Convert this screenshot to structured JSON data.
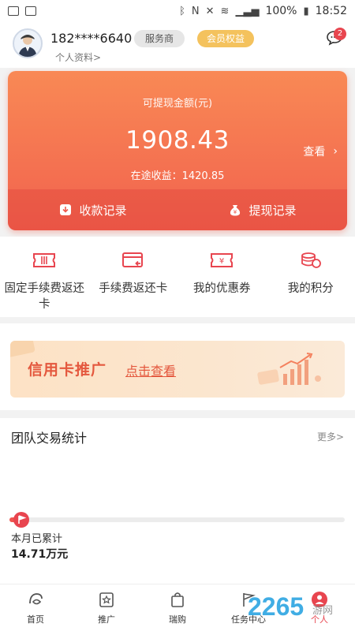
{
  "status_bar": {
    "battery": "100%",
    "time": "18:52"
  },
  "header": {
    "phone": "182****6640",
    "badge_service": "服务商",
    "badge_vip": "会员权益",
    "profile_link": "个人资料>",
    "message_count": "2"
  },
  "earnings": {
    "label": "可提现金额(元)",
    "amount": "1908.43",
    "view_label": "查看",
    "transit": "在途收益：1420.85",
    "receipt_records": "收款记录",
    "withdraw_records": "提现记录"
  },
  "actions": [
    {
      "label": "固定手续费返还卡",
      "icon": "ticket-icon"
    },
    {
      "label": "手续费返还卡",
      "icon": "card-return-icon"
    },
    {
      "label": "我的优惠券",
      "icon": "coupon-icon"
    },
    {
      "label": "我的积分",
      "icon": "coins-icon"
    }
  ],
  "promo": {
    "title": "信用卡推广",
    "link": "点击查看"
  },
  "team_stats": {
    "title": "团队交易统计",
    "more": "更多>",
    "month_label": "本月已累计",
    "month_value": "14.71万元",
    "progress": 0.04
  },
  "nav": [
    {
      "label": "首页",
      "icon": "home-icon"
    },
    {
      "label": "推广",
      "icon": "promote-icon"
    },
    {
      "label": "瑞购",
      "icon": "shopping-bag-icon"
    },
    {
      "label": "任务中心",
      "icon": "task-icon"
    },
    {
      "label": "个人",
      "icon": "person-icon"
    }
  ],
  "colors": {
    "accent": "#f1624e",
    "card_top": "#f98955",
    "vip_badge": "#f4c25d",
    "badge_red": "#e8454f"
  }
}
